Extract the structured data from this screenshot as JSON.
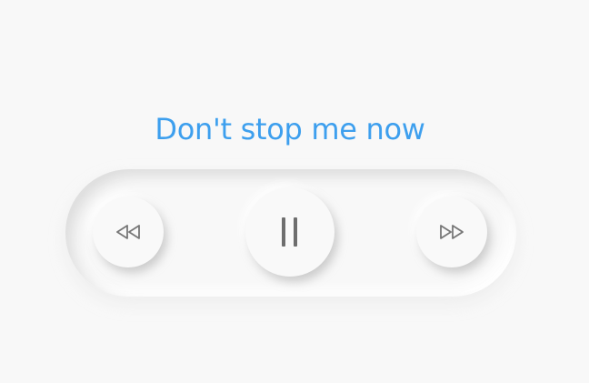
{
  "player": {
    "song_title": "Don't stop me now",
    "accent_color": "#3d9fee",
    "controls": {
      "rewind_icon": "rewind-icon",
      "pause_icon": "pause-icon",
      "forward_icon": "fast-forward-icon"
    }
  }
}
